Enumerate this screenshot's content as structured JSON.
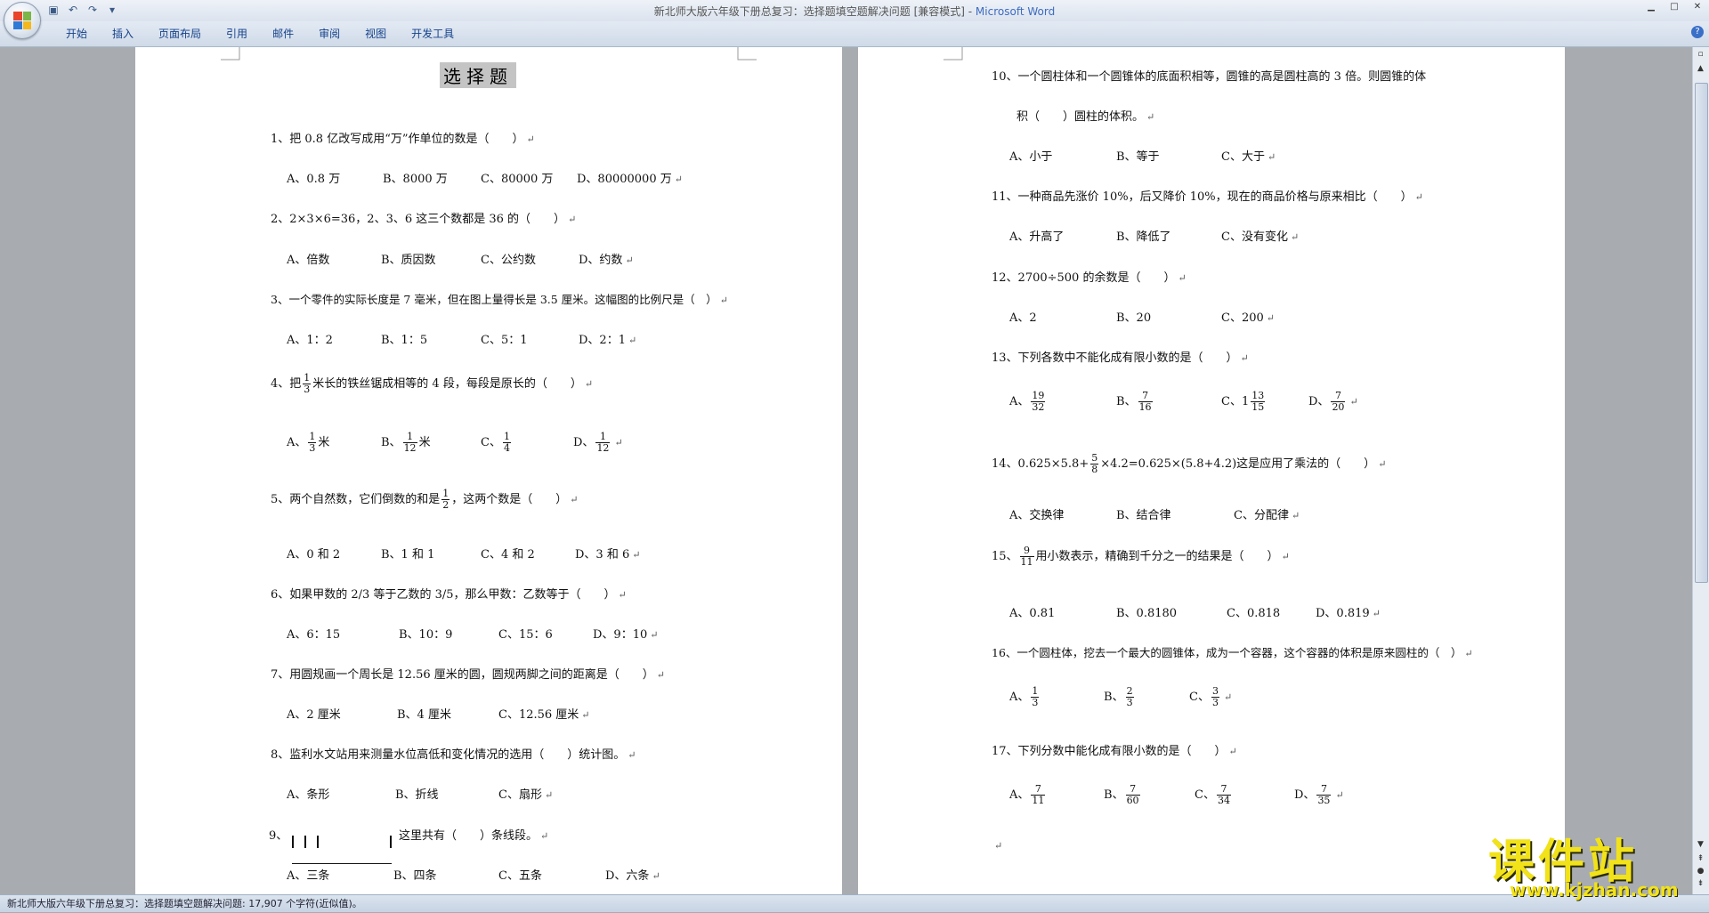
{
  "window": {
    "title": "新北师大版六年级下册总复习：选择题填空题解决问题 [兼容模式] - ",
    "app": "Microsoft Word"
  },
  "ribbon": {
    "tabs": [
      "开始",
      "插入",
      "页面布局",
      "引用",
      "邮件",
      "审阅",
      "视图",
      "开发工具"
    ]
  },
  "status": "新北师大版六年级下册总复习：选择题填空题解决问题: 17,907 个字符(近似值)。",
  "watermark": {
    "big": "课件站",
    "url": "www.kjzhan.com"
  },
  "mark": "↵",
  "page1": {
    "heading": "选择题",
    "q1": "1、把 0.8 亿改写成用“万”作单位的数是（　　）",
    "q1_opts": [
      "A、0.8 万",
      "B、8000 万",
      "C、80000 万",
      "D、80000000 万"
    ],
    "q2": "2、2×3×6=36，2、3、6 这三个数都是 36 的（　　）",
    "q2_opts": [
      "A、倍数",
      "B、质因数",
      "C、公约数",
      "D、约数"
    ],
    "q3": "3、一个零件的实际长度是 7 毫米，但在图上量得长是 3.5 厘米。这幅图的比例尺是（　）",
    "q3_opts": [
      "A、1：2",
      "B、1：5",
      "C、5：1",
      "D、2：1"
    ],
    "q4_pre": "4、把",
    "q4_frac": [
      "1",
      "3"
    ],
    "q4_post": "米长的铁丝锯成相等的 4 段，每段是原长的（　　）",
    "q4_opts": [
      {
        "p": "A、",
        "n": "1",
        "d": "3",
        "s": "米"
      },
      {
        "p": "B、",
        "n": "1",
        "d": "12",
        "s": "米"
      },
      {
        "p": "C、",
        "n": "1",
        "d": "4",
        "s": ""
      },
      {
        "p": "D、",
        "n": "1",
        "d": "12",
        "s": ""
      }
    ],
    "q5_pre": "5、两个自然数，它们倒数的和是",
    "q5_frac": [
      "1",
      "2"
    ],
    "q5_post": "，这两个数是（　　）",
    "q5_opts": [
      "A、0 和 2",
      "B、1 和 1",
      "C、4 和 2",
      "D、3 和 6"
    ],
    "q6": "6、如果甲数的 2/3 等于乙数的 3/5，那么甲数：乙数等于（　　）",
    "q6_opts": [
      "A、6：15",
      "B、10：9",
      "C、15：6",
      "D、9：10"
    ],
    "q7": "7、用圆规画一个周长是 12.56 厘米的圆，圆规两脚之间的距离是（　　）",
    "q7_opts": [
      "A、2 厘米",
      "B、4 厘米",
      "C、12.56 厘米"
    ],
    "q8": "8、监利水文站用来测量水位高低和变化情况的选用（　　）统计图。",
    "q8_opts": [
      "A、条形",
      "B、折线",
      "C、扇形"
    ],
    "q9_pre": "9、",
    "q9_post": "这里共有（　　）条线段。",
    "q9_opts": [
      "A、三条",
      "B、四条",
      "C、五条",
      "D、六条"
    ]
  },
  "page2": {
    "q10a": "10、一个圆柱体和一个圆锥体的底面积相等，圆锥的高是圆柱高的 3 倍。则圆锥的体",
    "q10b": "积（　　）圆柱的体积。",
    "q10_opts": [
      "A、小于",
      "B、等于",
      "C、大于"
    ],
    "q11": "11、一种商品先涨价 10%，后又降价 10%，现在的商品价格与原来相比（　　）",
    "q11_opts": [
      "A、升高了",
      "B、降低了",
      "C、没有变化"
    ],
    "q12": "12、2700÷500 的余数是（　　）",
    "q12_opts": [
      "A、2",
      "B、20",
      "C、200"
    ],
    "q13": "13、下列各数中不能化成有限小数的是（　　）",
    "q13_opts": [
      {
        "p": "A、",
        "w": "",
        "n": "19",
        "d": "32"
      },
      {
        "p": "B、",
        "w": "",
        "n": "7",
        "d": "16"
      },
      {
        "p": "C、",
        "w": "1",
        "n": "13",
        "d": "15"
      },
      {
        "p": "D、",
        "w": "",
        "n": "7",
        "d": "20"
      }
    ],
    "q14_pre": "14、0.625×5.8+",
    "q14_frac": [
      "5",
      "8"
    ],
    "q14_post": "×4.2=0.625×(5.8+4.2)这是应用了乘法的（　　）",
    "q14_opts": [
      "A、交换律",
      "B、结合律",
      "C、分配律"
    ],
    "q15_pre": "15、",
    "q15_frac": [
      "9",
      "11"
    ],
    "q15_post": "用小数表示，精确到千分之一的结果是（　　）",
    "q15_opts": [
      "A、0.81",
      "B、0.8180",
      "C、0.818",
      "D、0.819"
    ],
    "q16": "16、一个圆柱体，挖去一个最大的圆锥体，成为一个容器，这个容器的体积是原来圆柱的（　）",
    "q16_opts": [
      {
        "p": "A、",
        "n": "1",
        "d": "3"
      },
      {
        "p": "B、",
        "n": "2",
        "d": "3"
      },
      {
        "p": "C、",
        "n": "3",
        "d": "3"
      }
    ],
    "q17": "17、下列分数中能化成有限小数的是（　　）",
    "q17_opts": [
      {
        "p": "A、",
        "n": "7",
        "d": "11"
      },
      {
        "p": "B、",
        "n": "7",
        "d": "60"
      },
      {
        "p": "C、",
        "n": "7",
        "d": "34"
      },
      {
        "p": "D、",
        "n": "7",
        "d": "35"
      }
    ]
  }
}
